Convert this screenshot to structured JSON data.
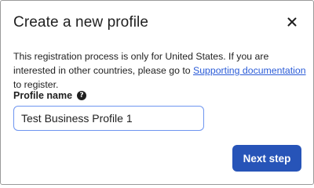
{
  "dialog": {
    "title": "Create a new profile",
    "close_icon": "close-icon"
  },
  "description": {
    "text_before": "This registration process is only for United States. If you are interested in other countries, please go to ",
    "link_text": "Supporting documentation ",
    "text_after": "to register."
  },
  "profile_name": {
    "label": "Profile name",
    "help_icon": "question-circle-icon",
    "help_glyph": "?",
    "value": "Test Business Profile 1"
  },
  "footer": {
    "next_label": "Next step"
  },
  "colors": {
    "primary_button": "#2754b8",
    "link": "#2a5bd7",
    "input_focus_border": "#6e95f0"
  }
}
